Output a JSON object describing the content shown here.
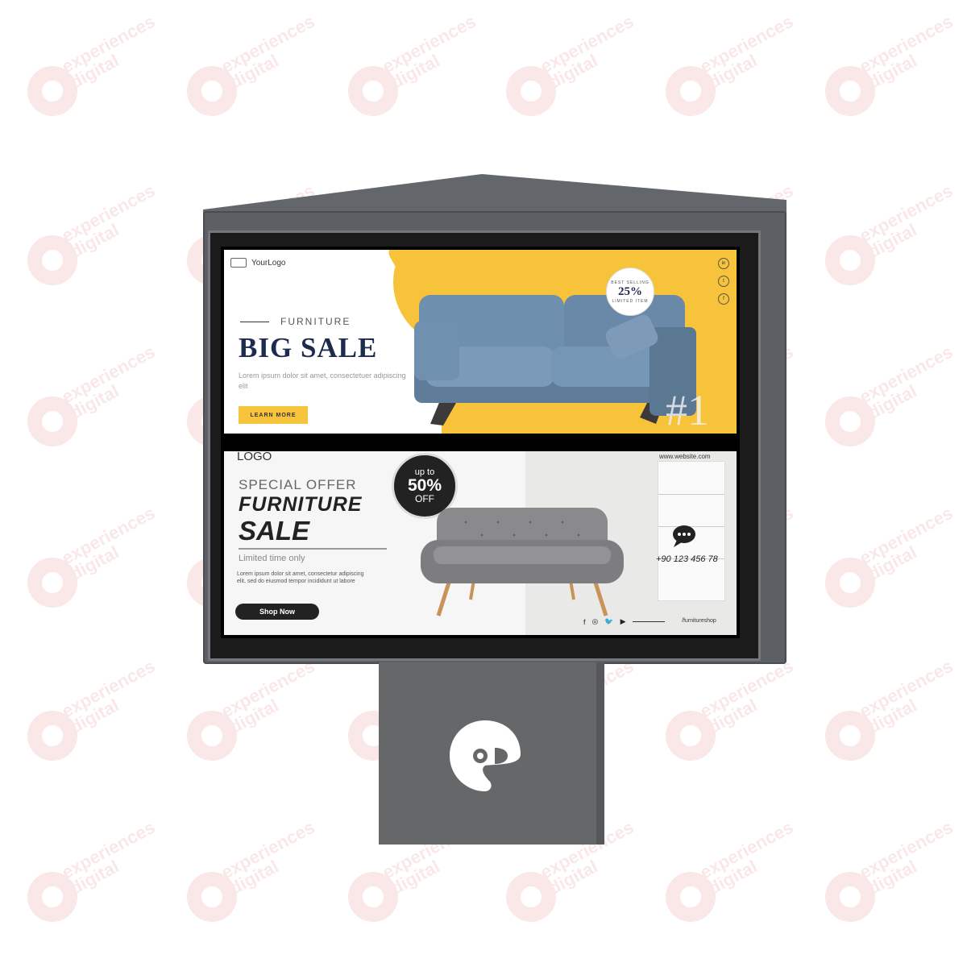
{
  "watermark": {
    "line1": "experiences",
    "line2": "digital"
  },
  "ad_top": {
    "logo_text": "YourLogo",
    "kicker": "FURNITURE",
    "headline": "BIG SALE",
    "description": "Lorem ipsum dolor sit amet, consectetuer adipiscing elit",
    "button": "LEARN MORE",
    "badge_top": "BEST SELLING",
    "badge_value": "25%",
    "badge_bottom": "LIMITED ITEM",
    "rank": "#1",
    "socials": [
      "in",
      "t",
      "f"
    ],
    "colors": {
      "accent": "#f6c33b",
      "headline": "#1d2b4f",
      "sofa": "#6f8fae"
    }
  },
  "ad_bottom": {
    "logo_text": "LOGO",
    "offer": "SPECIAL OFFER",
    "title_line1": "FURNITURE",
    "title_line2": "SALE",
    "subtitle": "Limited time only",
    "description": "Lorem ipsum dolor sit amet, consectetur adipiscing elit, sed do eiusmod tempor incididunt ut labore",
    "button": "Shop Now",
    "badge_upto": "up to",
    "badge_value": "50%",
    "badge_off": "OFF",
    "website": "www.website.com",
    "phone": "+90 123 456 78",
    "social_icons": [
      "f",
      "◎",
      "🐦",
      "▶"
    ],
    "handle": "/furnitureshop",
    "colors": {
      "dark": "#222222",
      "sofa": "#8a8a8c",
      "legs": "#c8935a"
    }
  }
}
